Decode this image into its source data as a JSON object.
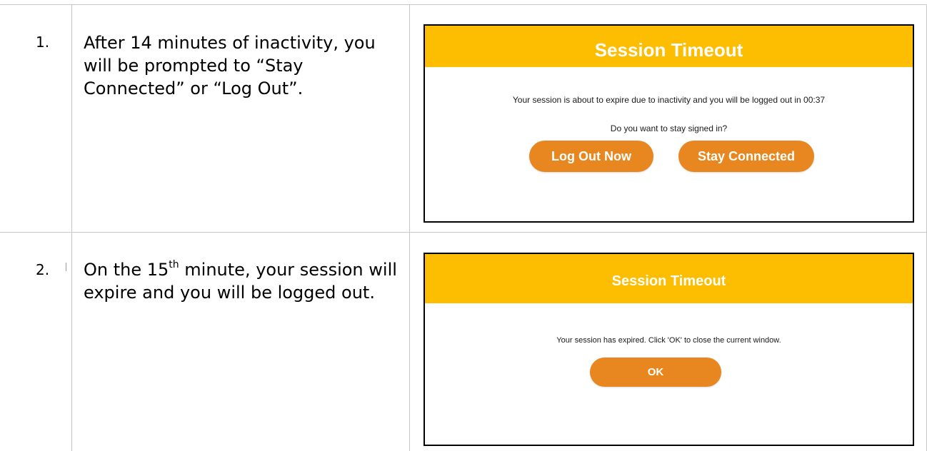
{
  "steps": [
    {
      "number": "1.",
      "text": "After 14 minutes of inactivity, you will be prompted to “Stay Connected” or “Log Out”.",
      "dialog": {
        "title": "Session Timeout",
        "message": "Your session is about to expire due to inactivity and you will be logged out in 00:37",
        "question": "Do you want to stay signed in?",
        "buttons": [
          "Log Out Now",
          "Stay Connected"
        ]
      }
    },
    {
      "number": "2.",
      "text_before": "On the 15",
      "text_sup": "th",
      "text_after": " minute, your session will expire and you will be logged out.",
      "dialog": {
        "title": "Session Timeout",
        "message": "Your session has expired. Click 'OK' to close the current window.",
        "buttons": [
          "OK"
        ]
      }
    }
  ],
  "colors": {
    "header": "#fdbd00",
    "button": "#e8861f",
    "border": "#c9c9c9"
  }
}
